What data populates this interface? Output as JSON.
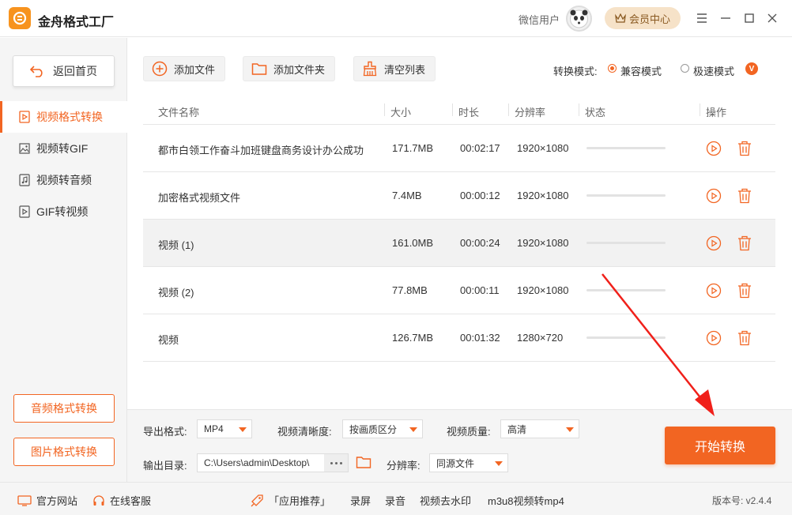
{
  "app": {
    "title": "金舟格式工厂",
    "user_label": "微信用户",
    "vip_label": "会员中心"
  },
  "sidebar": {
    "home_label": "返回首页",
    "items": [
      {
        "label": "视频格式转换"
      },
      {
        "label": "视频转GIF"
      },
      {
        "label": "视频转音频"
      },
      {
        "label": "GIF转视频"
      }
    ],
    "audio_btn": "音频格式转换",
    "image_btn": "图片格式转换"
  },
  "toolbar": {
    "add_file": "添加文件",
    "add_folder": "添加文件夹",
    "clear_list": "清空列表",
    "mode_label": "转换模式:",
    "mode_compat": "兼容模式",
    "mode_fast": "极速模式",
    "vip_badge": "V"
  },
  "table": {
    "headers": {
      "name": "文件名称",
      "size": "大小",
      "duration": "时长",
      "resolution": "分辨率",
      "status": "状态",
      "action": "操作"
    },
    "rows": [
      {
        "name": "都市白领工作奋斗加班键盘商务设计办公成功",
        "size": "171.7MB",
        "duration": "00:02:17",
        "resolution": "1920×1080",
        "progress": 0
      },
      {
        "name": "加密格式视频文件",
        "size": "7.4MB",
        "duration": "00:00:12",
        "resolution": "1920×1080",
        "progress": 0
      },
      {
        "name": "视频 (1)",
        "size": "161.0MB",
        "duration": "00:00:24",
        "resolution": "1920×1080",
        "progress": 0
      },
      {
        "name": "视频 (2)",
        "size": "77.8MB",
        "duration": "00:00:11",
        "resolution": "1920×1080",
        "progress": 0
      },
      {
        "name": "视频",
        "size": "126.7MB",
        "duration": "00:01:32",
        "resolution": "1280×720",
        "progress": 0
      }
    ]
  },
  "settings": {
    "format_label": "导出格式:",
    "format_value": "MP4",
    "clarity_label": "视频清晰度:",
    "clarity_value": "按画质区分",
    "quality_label": "视频质量:",
    "quality_value": "高清",
    "output_label": "输出目录:",
    "output_path": "C:\\Users\\admin\\Desktop\\",
    "resolution_label": "分辨率:",
    "resolution_value": "同源文件",
    "start_label": "开始转换"
  },
  "footer": {
    "website": "官方网站",
    "service": "在线客服",
    "recommend": "「应用推荐」",
    "links": [
      "录屏",
      "录音",
      "视频去水印",
      "m3u8视频转mp4"
    ],
    "version": "版本号: v2.4.4"
  },
  "colors": {
    "accent": "#f26522",
    "logo": "#f7931e"
  }
}
